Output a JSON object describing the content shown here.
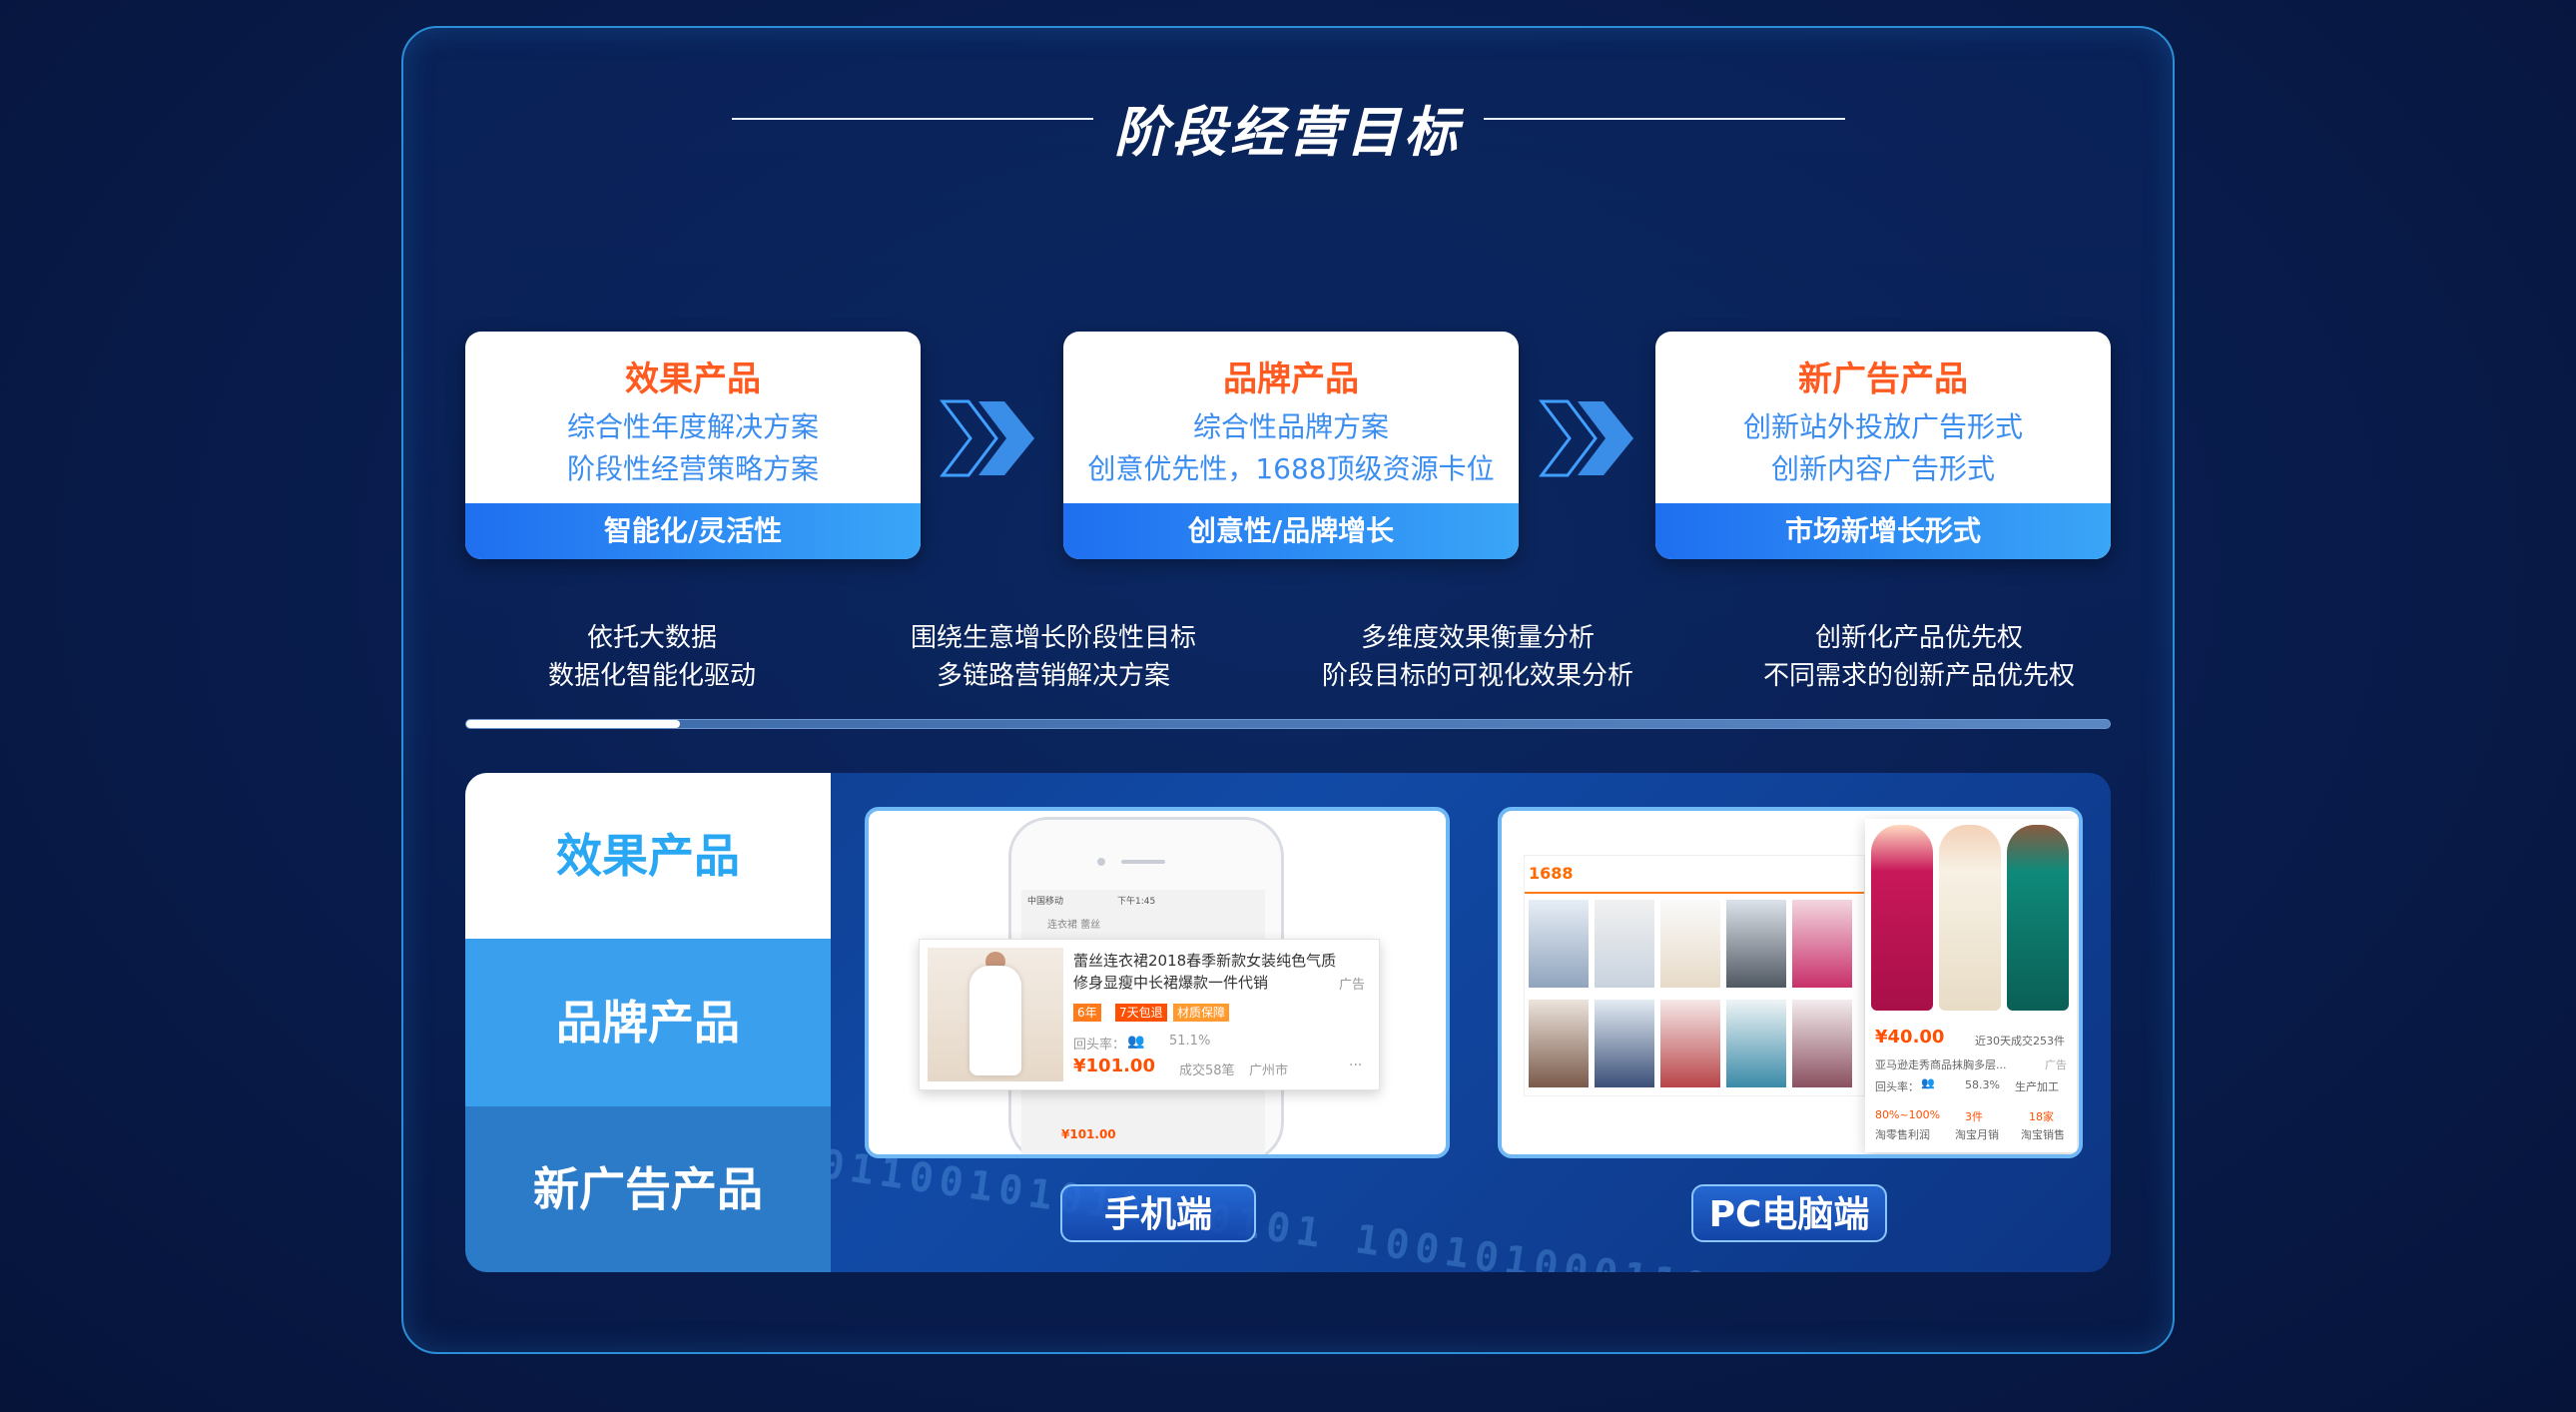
{
  "header": {
    "title": "阶段经营目标"
  },
  "cards": [
    {
      "title": "效果产品",
      "line1": "综合性年度解决方案",
      "line2": "阶段性经营策略方案",
      "bar": "智能化/灵活性"
    },
    {
      "title": "品牌产品",
      "line1": "综合性品牌方案",
      "line2": "创意优先性，1688顶级资源卡位",
      "bar": "创意性/品牌增长"
    },
    {
      "title": "新广告产品",
      "line1": "创新站外投放广告形式",
      "line2": "创新内容广告形式",
      "bar": "市场新增长形式"
    }
  ],
  "descriptions": [
    {
      "line1": "依托大数据",
      "line2": "数据化智能化驱动"
    },
    {
      "line1": "围绕生意增长阶段性目标",
      "line2": "多链路营销解决方案"
    },
    {
      "line1": "多维度效果衡量分析",
      "line2": "阶段目标的可视化效果分析"
    },
    {
      "line1": "创新化产品优先权",
      "line2": "不同需求的创新产品优先权"
    }
  ],
  "progress": {
    "fraction": 0.13
  },
  "tabs": [
    {
      "label": "效果产品",
      "active": true
    },
    {
      "label": "品牌产品",
      "active": false
    },
    {
      "label": "新广告产品",
      "active": false
    }
  ],
  "devices": {
    "mobile": "手机端",
    "pc": "PC电脑端"
  },
  "mobile_ad": {
    "title1": "蕾丝连衣裙2018春季新款女装纯色气质",
    "title2": "修身显瘦中长裙爆款一件代销",
    "ad_tag": "广告",
    "tags": [
      "6年",
      "7天包退",
      "材质保障"
    ],
    "return_rate_label": "回头率：",
    "return_rate": "51.1%",
    "price": "¥101.00",
    "sales": "成交58笔",
    "location": "广州市",
    "phone_carrier": "中国移动",
    "phone_time": "下午1:45",
    "search_text": "连衣裙 蕾丝",
    "under_price": "¥101.00"
  },
  "pc_ad": {
    "logo": "1688",
    "price": "¥40.00",
    "recent": "近30天成交253件",
    "name": "亚马逊走秀商品抹胸多层...",
    "ad_tag": "广告",
    "return_rate_label": "回头率：",
    "return_rate": "58.3%",
    "service": "生产加工",
    "stat1_value": "80%~100%",
    "stat1_label": "淘零售利润",
    "stat2_value": "3件",
    "stat2_label": "淘宝月销",
    "stat3_value": "18家",
    "stat3_label": "淘宝销售"
  },
  "colors": {
    "accent_orange": "#ff5a1f",
    "accent_blue": "#3b8ef0",
    "bar_blue": "#1f6ff0"
  }
}
